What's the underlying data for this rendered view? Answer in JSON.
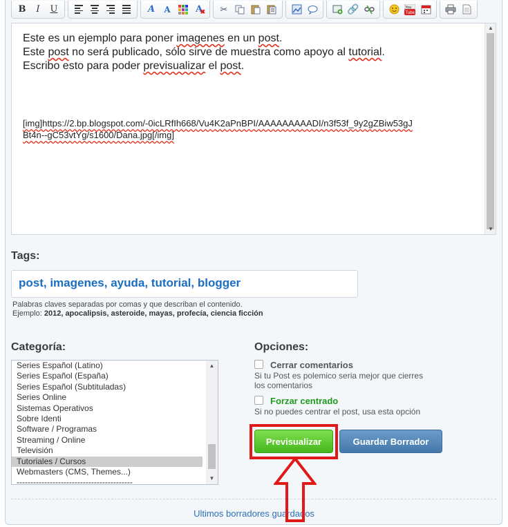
{
  "toolbar": {
    "groups": [
      [
        "bold-icon",
        "italic-icon",
        "underline-icon"
      ],
      [
        "align-left-icon",
        "align-center-icon",
        "align-right-icon",
        "align-justify-icon"
      ],
      [
        "font-icon",
        "font-size-icon",
        "color-icon",
        "clear-format-icon"
      ],
      [
        "cut-icon",
        "copy-icon",
        "paste-icon",
        "paste-text-icon"
      ],
      [
        "image-icon",
        "quote-icon"
      ],
      [
        "insert-image-icon",
        "link-icon",
        "unlink-icon"
      ],
      [
        "emoticon-icon",
        "youtube-icon",
        "calendar-icon"
      ],
      [
        "print-icon",
        "document-icon"
      ]
    ],
    "bold_label": "B",
    "italic_label": "I",
    "underline_label": "U"
  },
  "editor": {
    "line1_parts": [
      "Este es un ejemplo para poner ",
      "imagenes",
      " en un ",
      "post",
      "."
    ],
    "line2_parts": [
      "Este ",
      "post",
      " no será publicado, sólo sirve de muestra como apoyo al ",
      "tutorial",
      "."
    ],
    "line3_parts": [
      "Escribo esto para poder ",
      "previsualizar",
      " el ",
      "post",
      "."
    ],
    "url_line1": "[img]https://2.bp.blogspot.com/-0icLRfIh668/Vu4K2aPnBPI/AAAAAAAAADI/n3f53f_9y2gZBiw53gJ",
    "url_line2": "Bt4n--gC53vtYg/s1600/Dana.jpg[/img]"
  },
  "tags": {
    "heading": "Tags:",
    "value": "post, imagenes, ayuda, tutorial, blogger",
    "hint_line1": "Palabras claves separadas por comas y que describan el contenido.",
    "hint_example_label": "Ejemplo: ",
    "hint_example_value": "2012, apocalipsis, asteroide, mayas, profecía, ciencia ficción"
  },
  "categoria": {
    "heading": "Categoría:",
    "options": [
      "Series Español (Latino)",
      "Series Español (España)",
      "Series Español (Subtituladas)",
      "Series Online",
      "Sistemas Operativos",
      "Sobre Identi",
      "Software / Programas",
      "Streaming / Online",
      "Televisión",
      "Tutoriales / Cursos",
      "Webmasters (CMS, Themes...)",
      "------------------------------------------"
    ],
    "selected": "Tutoriales / Cursos"
  },
  "opciones": {
    "heading": "Opciones:",
    "cerrar_label": "Cerrar comentarios",
    "cerrar_desc": "Si tu Post es polemico seria mejor que cierres los comentarios",
    "forzar_label": "Forzar centrado",
    "forzar_desc": "Si no puedes centrar el post, usa esta opción",
    "forzar_color": "#1f9a1f"
  },
  "buttons": {
    "preview": "Previsualizar",
    "save_draft": "Guardar Borrador"
  },
  "footer": {
    "link": "Ultimos borradores guardados"
  },
  "colors": {
    "highlight_frame": "#e01818",
    "preview_button": "#52c227",
    "save_button": "#4f82b5",
    "tags_text": "#1a6ec1"
  }
}
